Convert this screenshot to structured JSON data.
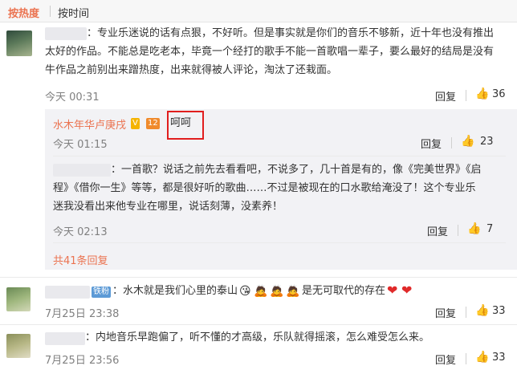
{
  "sort": {
    "hot": "按热度",
    "time": "按时间"
  },
  "comments": [
    {
      "user_tail": "：",
      "text_lines": [
        "：专业乐迷说的话有点狠，不好听。但是事实就是你们的音乐不够新，近十年也没有推出",
        "太好的作品。不能总是吃老本，毕竟一个经打的歌手不能一首歌唱一辈子，要么最好的结局是没有",
        "牛作品之前别出来蹭热度，出来就得被人评论，淘汰了还栽面。"
      ],
      "time": "今天 00:31",
      "reply": "回复",
      "likes": "36"
    },
    {
      "text": "：水木就是我们心里的泰山",
      "text_after": "是无可取代的存在",
      "badge": "铁粉",
      "time": "7月25日 23:38",
      "reply": "回复",
      "likes": "33"
    },
    {
      "text": "：内地音乐早跑偏了，听不懂的才高级，乐队就得摇滚，怎么难受怎么来。",
      "time": "7月25日 23:56",
      "reply": "回复",
      "likes": "33"
    }
  ],
  "subreplies": [
    {
      "user": "水木年华卢庚戌",
      "badge_v": "V",
      "badge_lv": "12",
      "text": "呵呵",
      "time": "今天 01:15",
      "reply": "回复",
      "likes": "23"
    },
    {
      "text_lines": [
        "：一首歌？说话之前先去看看吧，不说多了，几十首是有的，像《完美世界》《启",
        "程》《借你一生》等等，都是很好听的歌曲……不过是被现在的口水歌给淹没了！这个专业乐",
        "迷我没看出来他专业在哪里，说话刻薄，没素养！"
      ],
      "time": "今天 02:13",
      "reply": "回复",
      "likes": "7"
    }
  ],
  "more_replies": "共41条回复",
  "icons": {
    "thumb": "thumbs-up-icon",
    "heart": "heart-icon",
    "emoji": "emoji-icon"
  },
  "colors": {
    "accent": "#eb7350",
    "highlight_box": "#e11e1e"
  }
}
